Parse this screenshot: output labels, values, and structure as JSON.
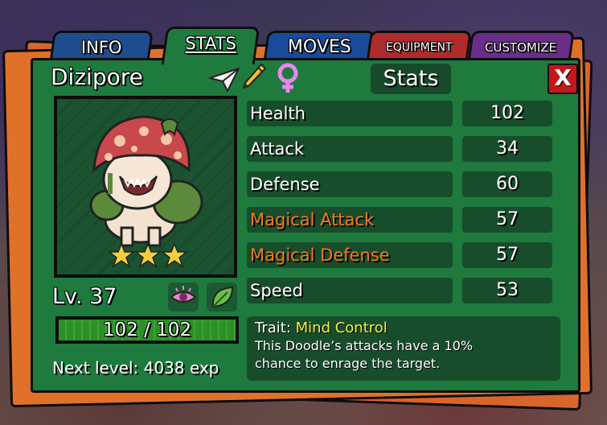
{
  "tabs": [
    {
      "label": "INFO"
    },
    {
      "label": "STATS"
    },
    {
      "label": "MOVES"
    },
    {
      "label": "EQUIPMENT"
    },
    {
      "label": "CUSTOMIZE"
    }
  ],
  "active_tab": "STATS",
  "creature": {
    "name": "Dizipore",
    "level_text": "Lv. 37",
    "stars": 3,
    "gender_icon": "female-symbol-icon",
    "types": [
      "psychic-eye-icon",
      "nature-leaf-icon"
    ],
    "hp_text": "102 / 102",
    "hp_fraction": 1.0,
    "next_level_text": "Next level: 4038 exp"
  },
  "panel_title": "Stats",
  "close_label": "X",
  "stats": [
    {
      "label": "Health",
      "value": "102",
      "magic": false
    },
    {
      "label": "Attack",
      "value": "34",
      "magic": false
    },
    {
      "label": "Defense",
      "value": "60",
      "magic": false
    },
    {
      "label": "Magical Attack",
      "value": "57",
      "magic": true
    },
    {
      "label": "Magical Defense",
      "value": "57",
      "magic": true
    },
    {
      "label": "Speed",
      "value": "53",
      "magic": false
    }
  ],
  "trait": {
    "prefix": "Trait:",
    "name": "Mind Control",
    "description_line1": "This Doodle’s attacks have a 10%",
    "description_line2": "chance to enrage the target."
  },
  "colors": {
    "panel_green": "#1f7a3e",
    "magic_orange": "#f07a1e",
    "trait_yellow": "#f2f23a",
    "close_red": "#c41818"
  }
}
